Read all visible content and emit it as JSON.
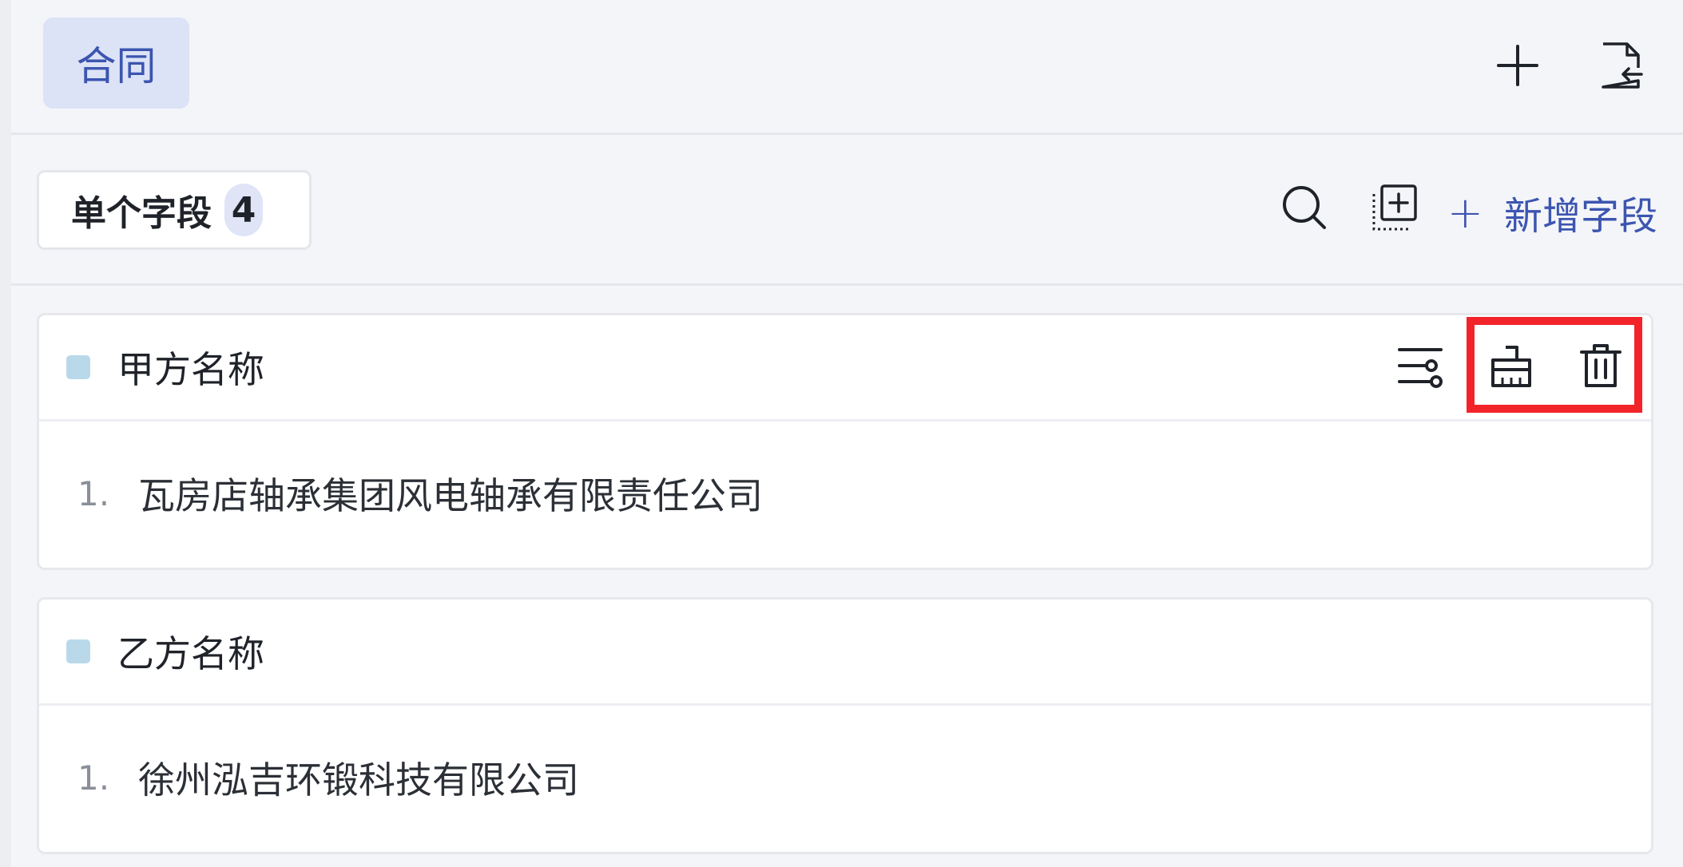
{
  "topbar": {
    "tab_label": "合同",
    "add_icon": "plus-icon",
    "import_icon": "file-import-icon"
  },
  "toolbar": {
    "segment_label": "单个字段",
    "segment_count": "4",
    "search_icon": "search-icon",
    "add_box_icon": "add-box-icon",
    "add_field_label": "新增字段"
  },
  "fields": [
    {
      "title": "甲方名称",
      "items": [
        {
          "index": "1.",
          "value": "瓦房店轴承集团风电轴承有限责任公司"
        }
      ]
    },
    {
      "title": "乙方名称",
      "items": [
        {
          "index": "1.",
          "value": "徐州泓吉环锻科技有限公司"
        }
      ]
    }
  ],
  "colors": {
    "accent": "#3c55b0",
    "highlight": "#f2242a",
    "swatch": "#b9d9ea"
  }
}
